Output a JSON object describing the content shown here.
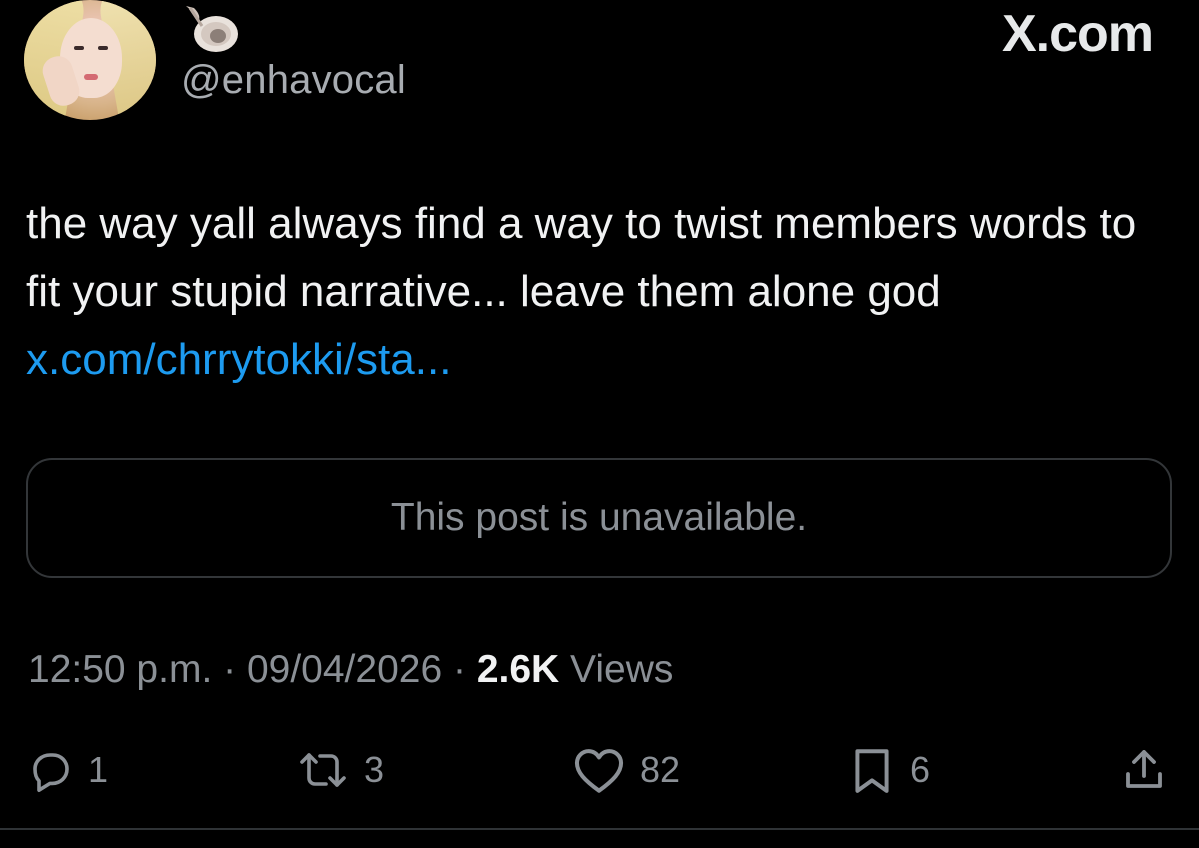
{
  "profile": {
    "handle": "@enhavocal",
    "avatar_icon": "avatar-photo",
    "badge_icon": "seashell-icon"
  },
  "brand": {
    "label": "X.com"
  },
  "tweet": {
    "text": "the way yall always find a way to twist members words to fit your stupid narrative... leave them alone god ",
    "link": "x.com/chrrytokki/sta..."
  },
  "quote": {
    "unavailable_text": "This post is unavailable."
  },
  "meta": {
    "time": "12:50 p.m.",
    "separator": " · ",
    "date": "09/04/2026",
    "views_count": "2.6K",
    "views_label": " Views"
  },
  "actions": {
    "reply": {
      "icon": "reply-icon",
      "count": "1"
    },
    "retweet": {
      "icon": "retweet-icon",
      "count": "3"
    },
    "like": {
      "icon": "heart-icon",
      "count": "82"
    },
    "bookmark": {
      "icon": "bookmark-icon",
      "count": "6"
    },
    "share": {
      "icon": "share-icon"
    }
  },
  "colors": {
    "background": "#000000",
    "text": "#e7e9ea",
    "secondary": "#8b9096",
    "link": "#1d9bf0",
    "border": "#333639"
  }
}
